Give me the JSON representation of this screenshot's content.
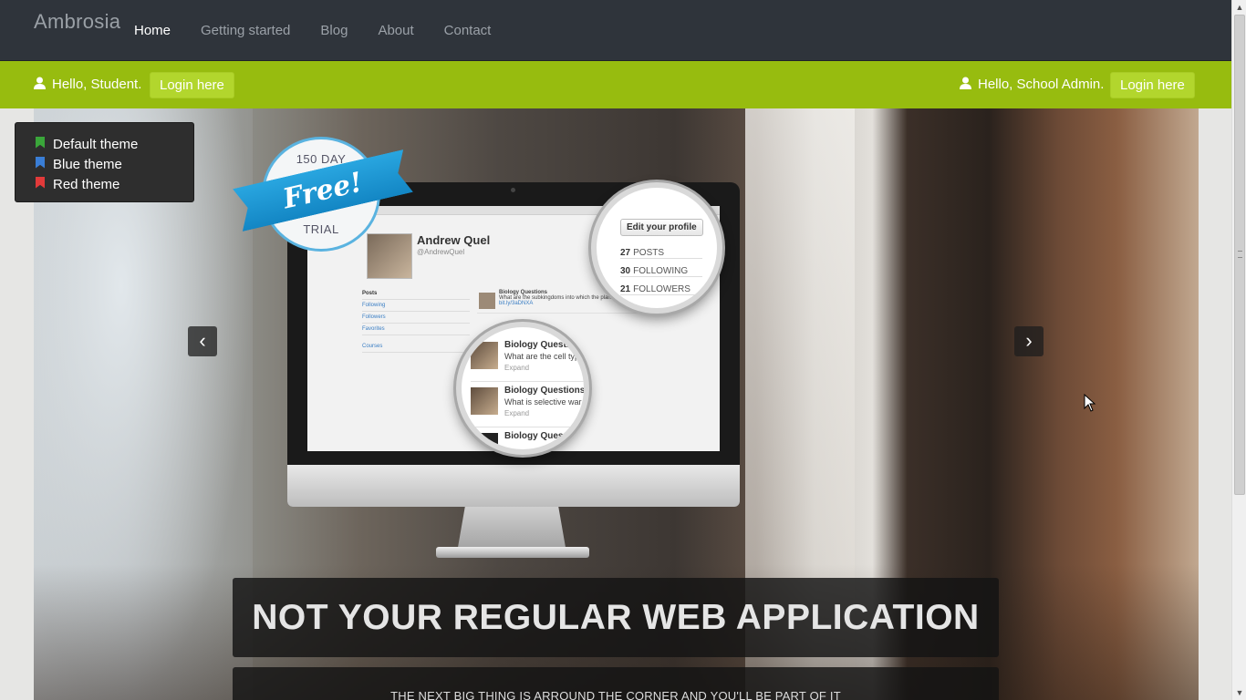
{
  "brand": "Ambrosia",
  "nav": {
    "items": [
      {
        "label": "Home",
        "active": true
      },
      {
        "label": "Getting started",
        "active": false
      },
      {
        "label": "Blog",
        "active": false
      },
      {
        "label": "About",
        "active": false
      },
      {
        "label": "Contact",
        "active": false
      }
    ]
  },
  "greenbar": {
    "student_greeting": "Hello, Student.",
    "student_login": "Login here",
    "admin_greeting": "Hello, School Admin.",
    "admin_login": "Login here",
    "icon": "user-icon"
  },
  "themes": {
    "items": [
      {
        "label": "Default theme",
        "color": "#3aa63a"
      },
      {
        "label": "Blue theme",
        "color": "#3a7ed6"
      },
      {
        "label": "Red theme",
        "color": "#e23a3a"
      }
    ]
  },
  "carousel": {
    "prev_icon": "chevron-left-icon",
    "next_icon": "chevron-right-icon",
    "prev_glyph": "‹",
    "next_glyph": "›",
    "badge": {
      "top": "150 DAY",
      "ribbon": "Free!",
      "bottom": "TRIAL"
    },
    "mockup": {
      "profile_name": "Andrew Quel",
      "profile_handle": "@AndrewQuel",
      "side_items": [
        "Posts",
        "Following",
        "Followers",
        "Favorites",
        "Courses"
      ],
      "feed_items": [
        "Biology Questions",
        "What are the subkingdoms into which the plant",
        "bit.ly/3aDNXA"
      ],
      "lens_button": "Edit your profile",
      "stats": [
        {
          "value": "27",
          "label": "POSTS"
        },
        {
          "value": "30",
          "label": "FOLLOWING"
        },
        {
          "value": "21",
          "label": "FOLLOWERS"
        }
      ],
      "questions": [
        {
          "title": "Biology Question",
          "text": "What are the cell typ",
          "expand": "Expand"
        },
        {
          "title": "Biology Questions",
          "text": "What is selective war",
          "expand": "Expand"
        },
        {
          "title": "Biology Ques",
          "text": "",
          "expand": ""
        }
      ]
    },
    "caption_title": "NOT YOUR REGULAR WEB APPLICATION",
    "caption_sub": "THE NEXT BIG THING IS ARROUND THE CORNER AND YOU'LL BE PART OF IT"
  },
  "colors": {
    "navbar": "#2f343b",
    "greenbar": "#97bc0f",
    "login_button": "#b2d62d"
  }
}
